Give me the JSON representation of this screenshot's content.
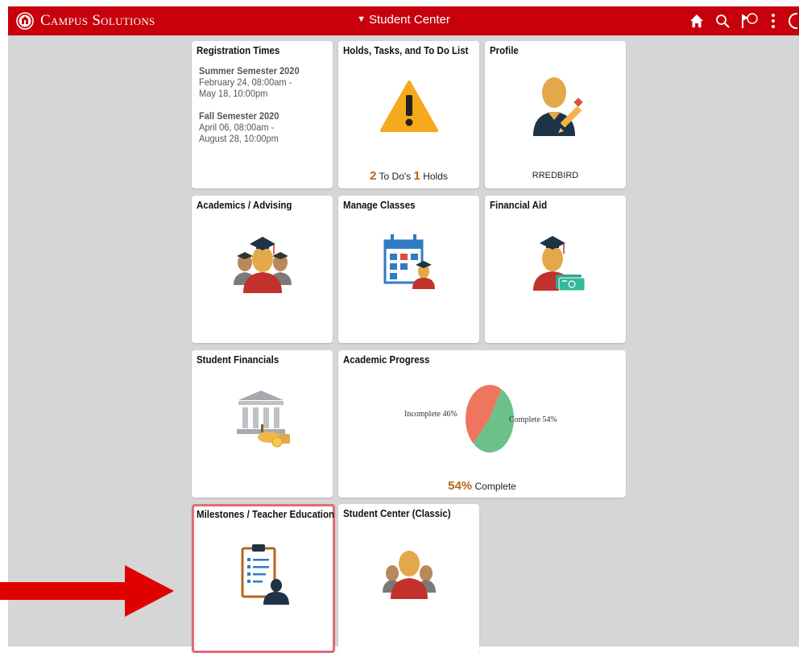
{
  "header": {
    "brand": "Campus Solutions",
    "title": "Student Center",
    "icons": [
      "home-icon",
      "search-icon",
      "notifications-flag-icon",
      "actions-menu-icon",
      "navbar-icon"
    ],
    "notification_count": "0",
    "colors": {
      "header_bg": "#c7000b",
      "content_bg": "#d6d6d6",
      "accent_number": "#b5651d",
      "highlight_border": "#e56b78",
      "arrow": "#e00000"
    }
  },
  "tiles": {
    "registration": {
      "title": "Registration Times",
      "terms": [
        {
          "name": "Summer Semester 2020",
          "start": "February 24, 08:00am -",
          "end": "May 18, 10:00pm"
        },
        {
          "name": "Fall Semester 2020",
          "start": "April 06, 08:00am -",
          "end": "August 28, 10:00pm"
        }
      ]
    },
    "holds": {
      "title": "Holds, Tasks, and To Do List",
      "todos_count": "2",
      "todos_label": "To Do's",
      "holds_count": "1",
      "holds_label": "Holds",
      "icon": "warning-icon"
    },
    "profile": {
      "title": "Profile",
      "username": "RREDBIRD",
      "icon": "profile-edit-icon"
    },
    "academics": {
      "title": "Academics / Advising",
      "icon": "graduates-icon"
    },
    "manage_classes": {
      "title": "Manage Classes",
      "icon": "calendar-student-icon"
    },
    "financial_aid": {
      "title": "Financial Aid",
      "icon": "graduate-money-icon"
    },
    "student_financials": {
      "title": "Student Financials",
      "icon": "bank-money-icon"
    },
    "academic_progress": {
      "title": "Academic Progress",
      "incomplete_label": "Incomplete 46%",
      "complete_label": "Complete 54%",
      "percent": "54%",
      "percent_label": "Complete",
      "incomplete_fraction": 0.46,
      "complete_fraction": 0.54,
      "incomplete_color": "#ee7560",
      "complete_color": "#6cc089"
    },
    "milestones": {
      "title": "Milestones / Teacher Education",
      "icon": "clipboard-person-icon"
    },
    "student_center_classic": {
      "title": "Student Center (Classic)",
      "icon": "student-avatar-icon"
    }
  }
}
